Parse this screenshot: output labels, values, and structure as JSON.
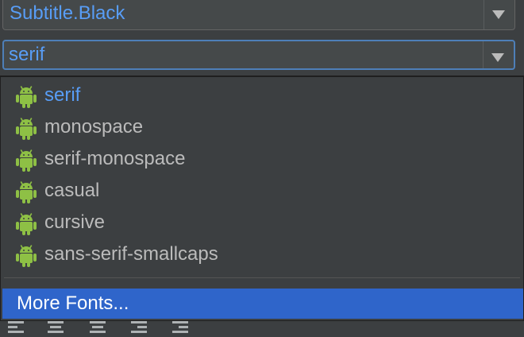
{
  "style_combo": {
    "value": "Subtitle.Black"
  },
  "font_combo": {
    "value": "serif"
  },
  "dropdown": {
    "items": [
      {
        "label": "serif",
        "icon": "android-icon",
        "selected": true
      },
      {
        "label": "monospace",
        "icon": "android-icon",
        "selected": false
      },
      {
        "label": "serif-monospace",
        "icon": "android-icon",
        "selected": false
      },
      {
        "label": "casual",
        "icon": "android-icon",
        "selected": false
      },
      {
        "label": "cursive",
        "icon": "android-icon",
        "selected": false
      },
      {
        "label": "sans-serif-smallcaps",
        "icon": "android-icon",
        "selected": false
      }
    ],
    "more_label": "More Fonts..."
  },
  "colors": {
    "accent": "#589df6",
    "android_green": "#8ec045",
    "highlight": "#2f65ca",
    "background": "#3c3f41"
  }
}
